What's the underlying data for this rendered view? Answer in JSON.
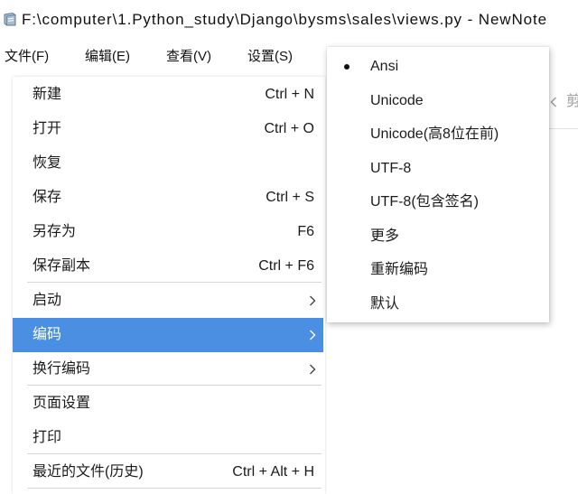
{
  "window": {
    "title": "F:\\computer\\1.Python_study\\Django\\bysms\\sales\\views.py - NewNote",
    "icon": "newnote-app-icon"
  },
  "menubar": {
    "items": [
      {
        "label": "文件(F)"
      },
      {
        "label": "编辑(E)"
      },
      {
        "label": "查看(V)"
      },
      {
        "label": "设置(S)"
      }
    ]
  },
  "file_menu": {
    "items": [
      {
        "label": "新建",
        "shortcut": "Ctrl + N"
      },
      {
        "label": "打开",
        "shortcut": "Ctrl + O"
      },
      {
        "label": "恢复"
      },
      {
        "label": "保存",
        "shortcut": "Ctrl + S"
      },
      {
        "label": "另存为",
        "shortcut": "F6"
      },
      {
        "label": "保存副本",
        "shortcut": "Ctrl + F6"
      },
      {
        "label": "启动",
        "has_submenu": true
      },
      {
        "label": "编码",
        "has_submenu": true,
        "highlighted": true
      },
      {
        "label": "换行编码",
        "has_submenu": true
      },
      {
        "label": "页面设置"
      },
      {
        "label": "打印"
      },
      {
        "label": "最近的文件(历史)",
        "shortcut": "Ctrl + Alt + H"
      }
    ]
  },
  "encoding_submenu": {
    "items": [
      {
        "label": "Ansi",
        "checked": true
      },
      {
        "label": "Unicode"
      },
      {
        "label": "Unicode(高8位在前)"
      },
      {
        "label": "UTF-8"
      },
      {
        "label": "UTF-8(包含签名)"
      },
      {
        "label": "更多"
      },
      {
        "label": "重新编码"
      },
      {
        "label": "默认"
      }
    ]
  },
  "background_toolbar": {
    "partial_label": "剪",
    "icon": "chevron-left-icon"
  },
  "colors": {
    "highlight": "#4a8fe2",
    "highlight_text": "#ffffff",
    "separator": "#d6d6d6",
    "muted": "#9a9a9a"
  }
}
